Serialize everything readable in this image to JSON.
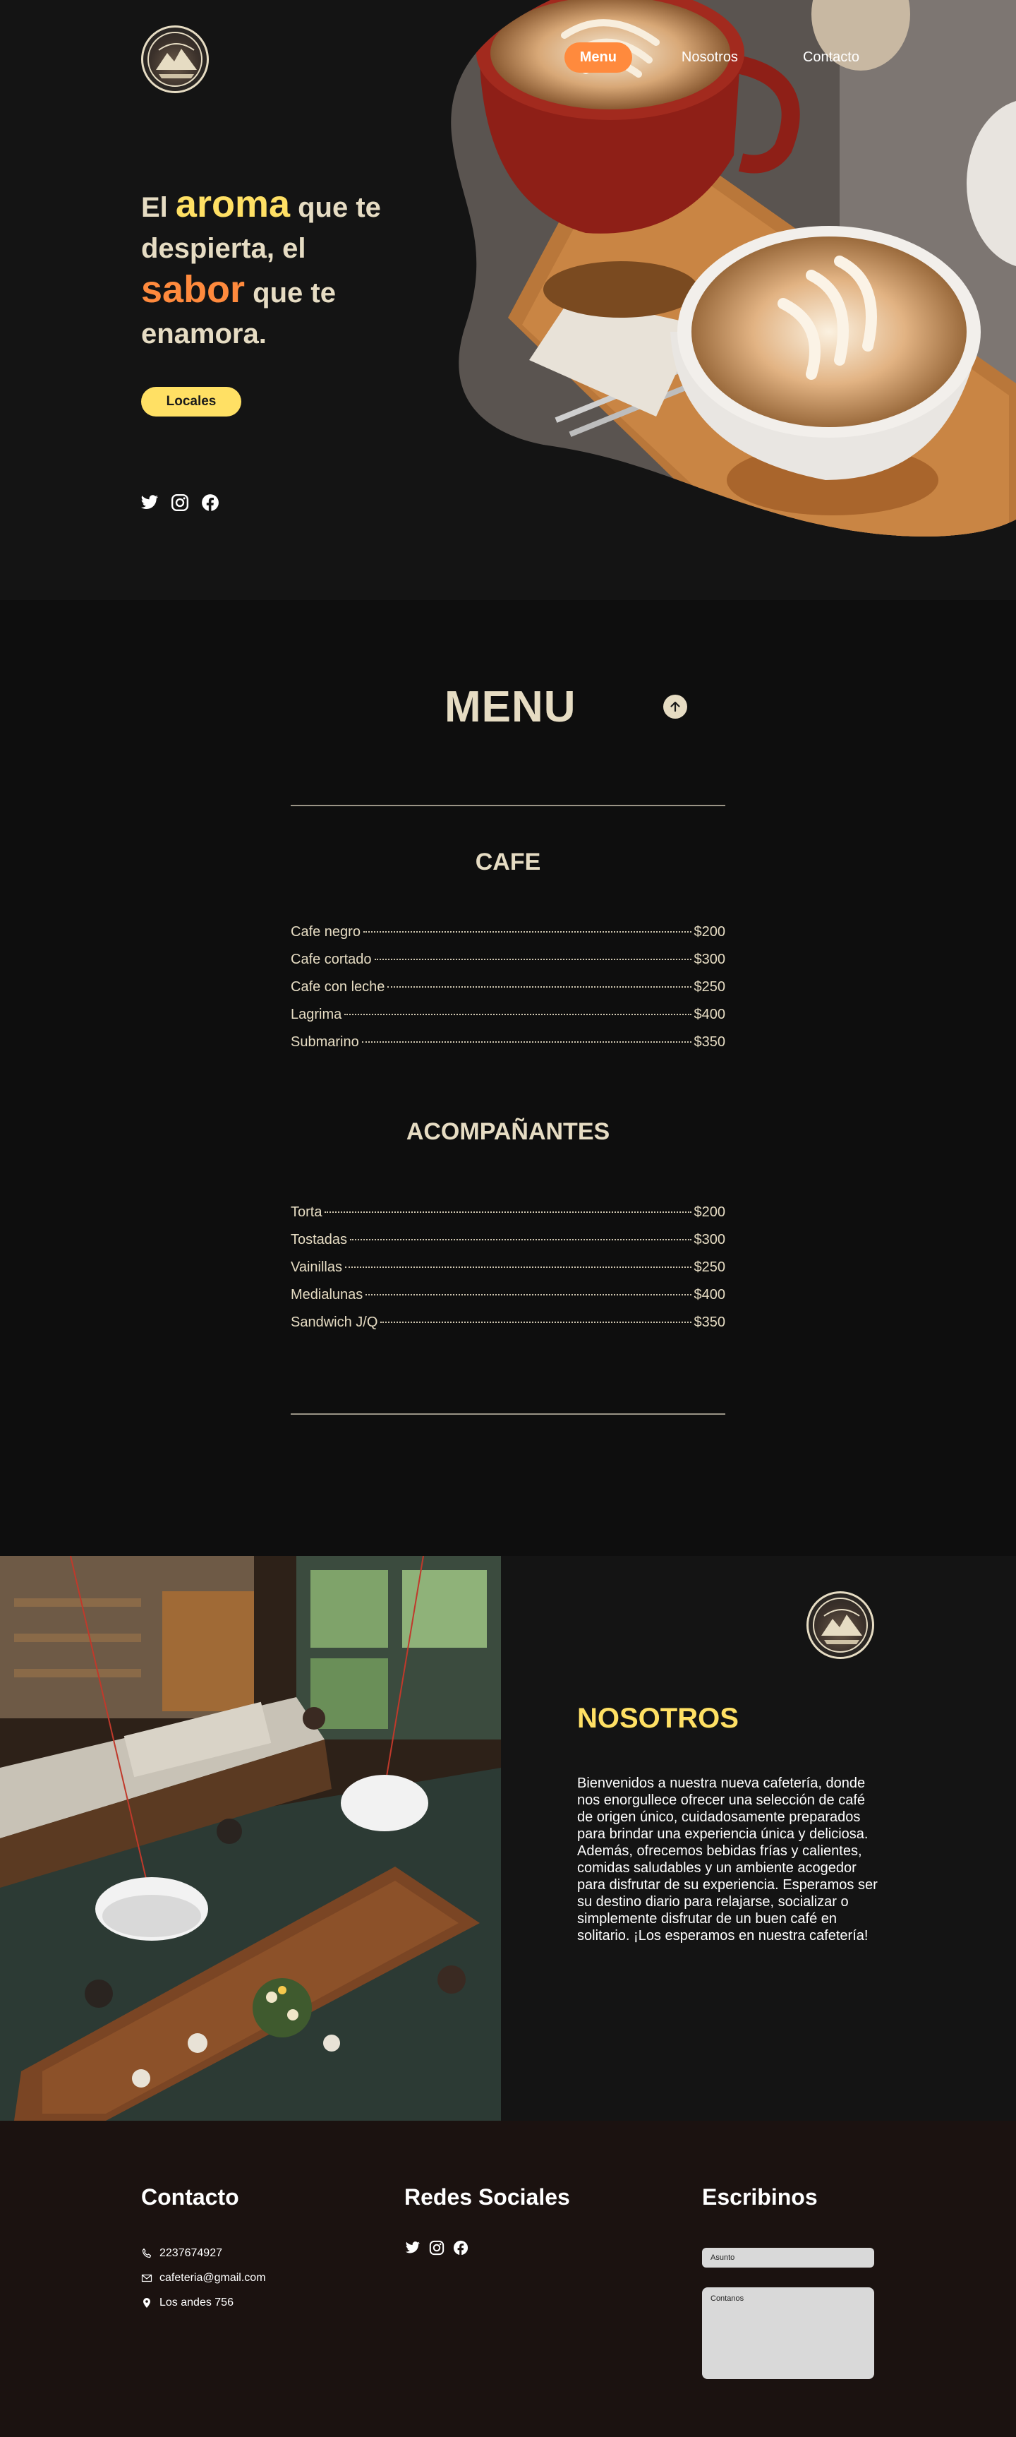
{
  "nav": {
    "items": [
      {
        "label": "Menu",
        "active": true
      },
      {
        "label": "Nosotros",
        "active": false
      },
      {
        "label": "Contacto",
        "active": false
      }
    ]
  },
  "hero": {
    "headline": {
      "part1": "El ",
      "aroma": "aroma",
      "part2": " que te despierta, el ",
      "sabor": "sabor",
      "part3": " que te enamora."
    },
    "cta_label": "Locales",
    "social_icons": [
      "twitter-icon",
      "instagram-icon",
      "facebook-icon"
    ]
  },
  "menu": {
    "title": "MENU",
    "categories": [
      {
        "title": "CAFE",
        "items": [
          {
            "name": "Cafe negro",
            "price": "$200"
          },
          {
            "name": "Cafe cortado",
            "price": "$300"
          },
          {
            "name": "Cafe con leche",
            "price": "$250"
          },
          {
            "name": "Lagrima",
            "price": "$400"
          },
          {
            "name": "Submarino",
            "price": "$350"
          }
        ]
      },
      {
        "title": "ACOMPAÑANTES",
        "items": [
          {
            "name": "Torta",
            "price": "$200"
          },
          {
            "name": "Tostadas",
            "price": "$300"
          },
          {
            "name": "Vainillas",
            "price": "$250"
          },
          {
            "name": "Medialunas",
            "price": "$400"
          },
          {
            "name": "Sandwich J/Q",
            "price": "$350"
          }
        ]
      }
    ]
  },
  "nosotros": {
    "title": "NOSOTROS",
    "text": "Bienvenidos a nuestra nueva cafetería, donde nos enorgullece ofrecer una selección de café de origen único, cuidadosamente preparados para brindar una experiencia única y deliciosa. Además, ofrecemos bebidas frías y calientes, comidas saludables y un ambiente acogedor para disfrutar de su experiencia. Esperamos ser su destino diario para relajarse, socializar o simplemente disfrutar de un buen café en solitario. ¡Los esperamos en nuestra cafetería!"
  },
  "footer": {
    "contact_title": "Contacto",
    "phone": "2237674927",
    "email": "cafeteria@gmail.com",
    "address": "Los andes 756",
    "social_title": "Redes Sociales",
    "write_title": "Escribinos",
    "subject_placeholder": "Asunto",
    "message_placeholder": "Contanos"
  },
  "colors": {
    "background": "#121212",
    "accent_yellow": "#ffe064",
    "accent_orange": "#ff8a3d",
    "cream": "#e6dcc3",
    "footer_bg": "#1b1210"
  }
}
